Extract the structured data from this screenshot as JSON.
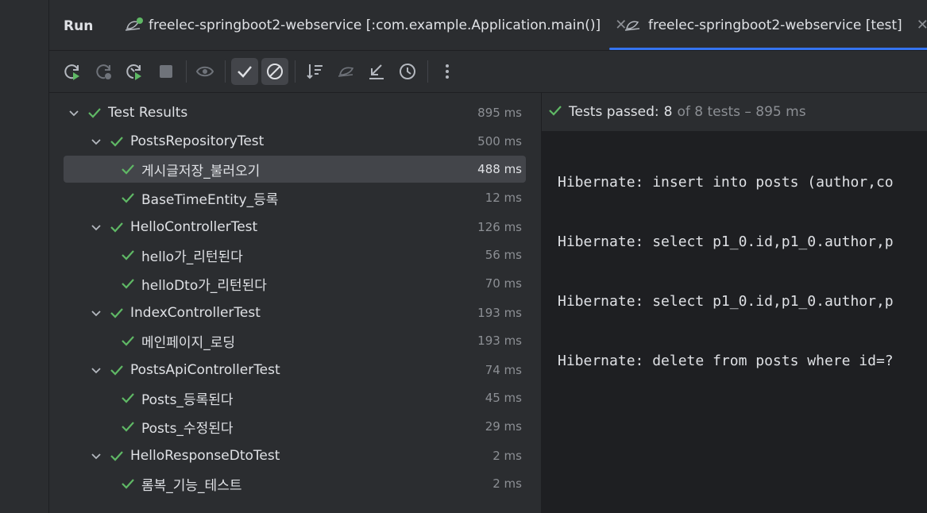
{
  "header": {
    "title": "Run",
    "tabs": [
      {
        "label": "freelec-springboot2-webservice [:com.example.Application.main()]",
        "active": false,
        "icon": "spring-run-icon"
      },
      {
        "label": "freelec-springboot2-webservice [test]",
        "active": true,
        "icon": "spring-test-icon"
      }
    ],
    "close_glyph": "✕"
  },
  "toolbar": {
    "buttons": [
      "rerun-icon",
      "rerun-failed-icon",
      "rerun-debug-icon",
      "stop-icon",
      "show-passed-toggle-icon",
      "show-passed-icon",
      "show-ignored-icon",
      "sort-icon",
      "import-tests-icon",
      "collapse-icon",
      "history-icon",
      "more-icon"
    ]
  },
  "tree": {
    "items": [
      {
        "label": "Test Results",
        "time": "895 ms",
        "level": 0,
        "expanded": true
      },
      {
        "label": "PostsRepositoryTest",
        "time": "500 ms",
        "level": 1,
        "expanded": true
      },
      {
        "label": "게시글저장_불러오기",
        "time": "488 ms",
        "level": 2,
        "selected": true
      },
      {
        "label": "BaseTimeEntity_등록",
        "time": "12 ms",
        "level": 2
      },
      {
        "label": "HelloControllerTest",
        "time": "126 ms",
        "level": 1,
        "expanded": true
      },
      {
        "label": "hello가_리턴된다",
        "time": "56 ms",
        "level": 2
      },
      {
        "label": "helloDto가_리턴된다",
        "time": "70 ms",
        "level": 2
      },
      {
        "label": "IndexControllerTest",
        "time": "193 ms",
        "level": 1,
        "expanded": true
      },
      {
        "label": "메인페이지_로딩",
        "time": "193 ms",
        "level": 2
      },
      {
        "label": "PostsApiControllerTest",
        "time": "74 ms",
        "level": 1,
        "expanded": true
      },
      {
        "label": "Posts_등록된다",
        "time": "45 ms",
        "level": 2
      },
      {
        "label": "Posts_수정된다",
        "time": "29 ms",
        "level": 2
      },
      {
        "label": "HelloResponseDtoTest",
        "time": "2 ms",
        "level": 1,
        "expanded": true
      },
      {
        "label": "롬복_기능_테스트",
        "time": "2 ms",
        "level": 2
      }
    ]
  },
  "console": {
    "status_label": "Tests passed:",
    "status_count": "8",
    "status_rest": "of 8 tests – 895 ms",
    "lines": [
      "Hibernate: insert into posts (author,co",
      "Hibernate: select p1_0.id,p1_0.author,p",
      "Hibernate: select p1_0.id,p1_0.author,p",
      "Hibernate: delete from posts where id=?"
    ]
  },
  "colors": {
    "background": "#2b2d30",
    "console_bg": "#1e1f22",
    "pass_green": "#5fb865",
    "accent": "#3574f0",
    "selected_row": "#43454a",
    "muted_text": "#8c8f94"
  }
}
